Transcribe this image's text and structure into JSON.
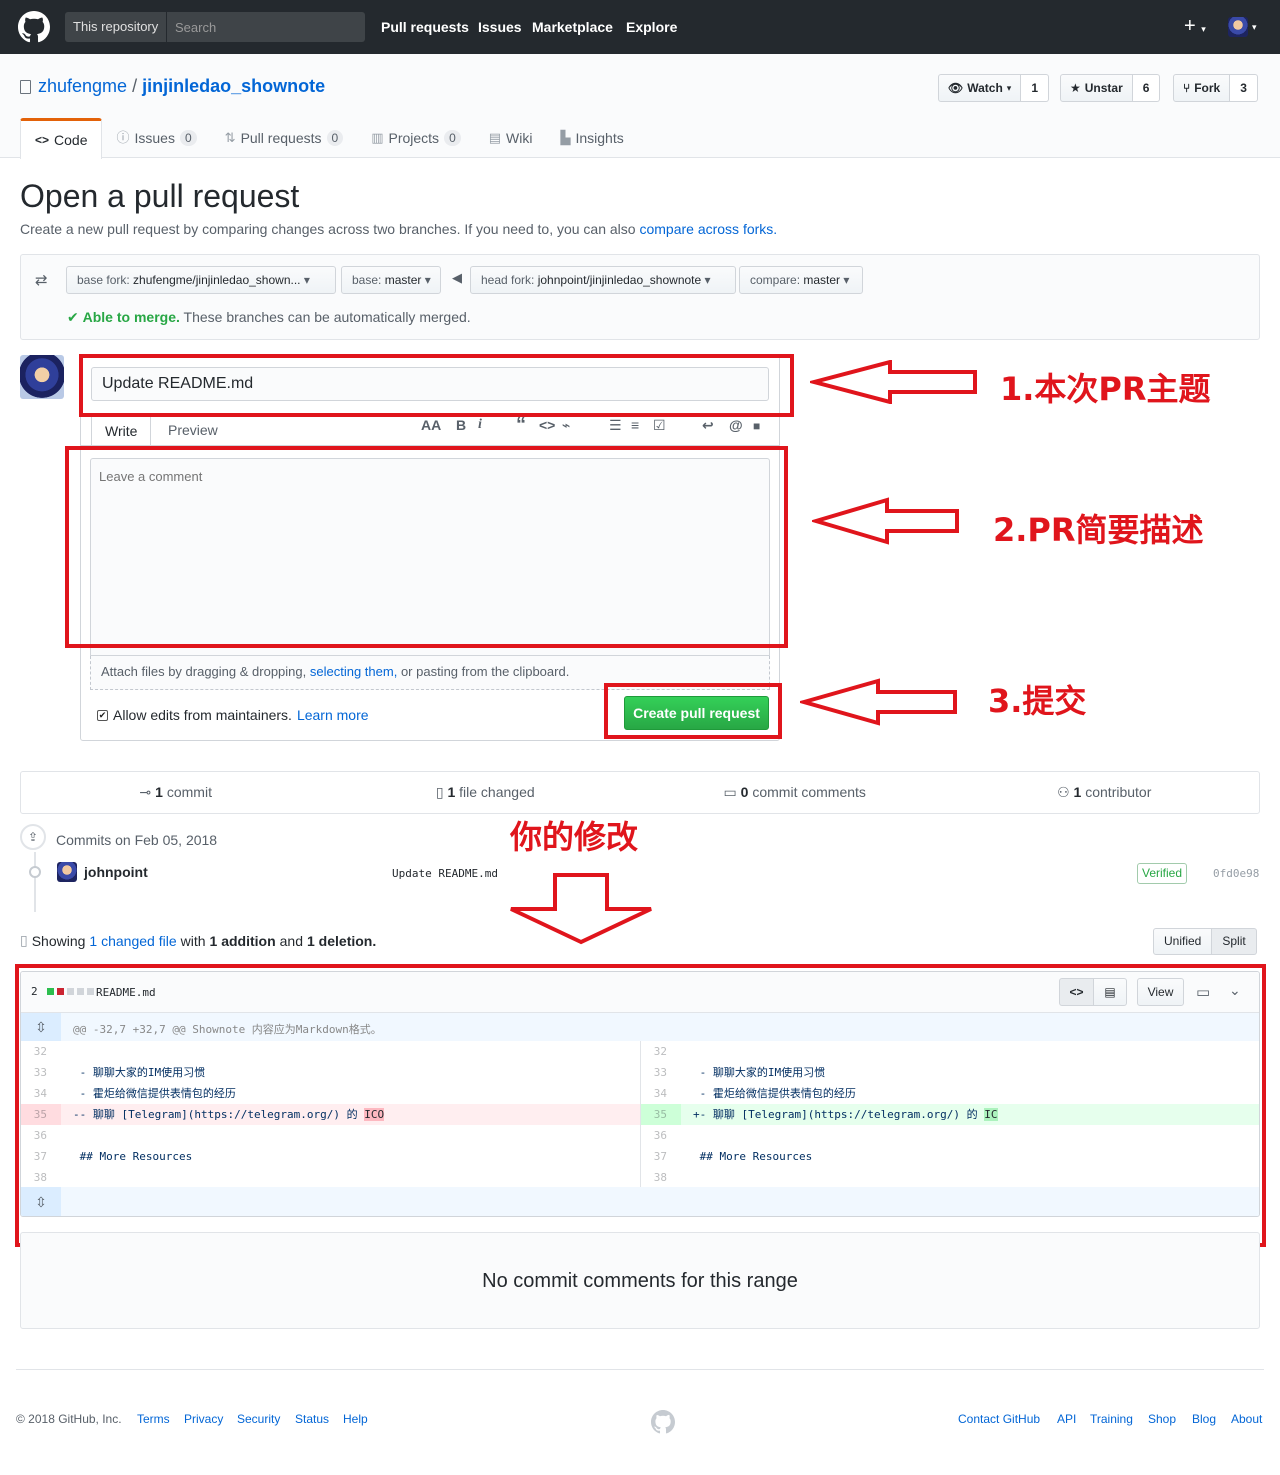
{
  "header": {
    "search_scope": "This repository",
    "search_placeholder": "Search",
    "nav": [
      "Pull requests",
      "Issues",
      "Marketplace",
      "Explore"
    ],
    "plus": "+"
  },
  "repo": {
    "owner": "zhufengme",
    "separator": "/",
    "name": "jinjinledao_shownote",
    "watch_label": "Watch",
    "watch_count": "1",
    "star_label": "Unstar",
    "star_count": "6",
    "fork_label": "Fork",
    "fork_count": "3",
    "tabs": [
      {
        "label": "Code",
        "icon": "<>"
      },
      {
        "label": "Issues",
        "count": "0"
      },
      {
        "label": "Pull requests",
        "count": "0"
      },
      {
        "label": "Projects",
        "count": "0"
      },
      {
        "label": "Wiki"
      },
      {
        "label": "Insights"
      }
    ]
  },
  "compare": {
    "title": "Open a pull request",
    "subtitle": "Create a new pull request by comparing changes across two branches. If you need to, you can also",
    "subtitle_link": "compare across forks.",
    "base_fork_label": "base fork:",
    "base_fork_value": "zhufengme/jinjinledao_shown...",
    "base_label": "base:",
    "base_value": "master",
    "head_fork_label": "head fork:",
    "head_fork_value": "johnpoint/jinjinledao_shownote",
    "compare_label": "compare:",
    "compare_value": "master",
    "merge_status": "Able to merge.",
    "merge_text": "These branches can be automatically merged."
  },
  "form": {
    "title_value": "Update README.md",
    "write_tab": "Write",
    "preview_tab": "Preview",
    "toolbar": [
      "AA",
      "B",
      "i",
      "“",
      "<>",
      "⌁",
      "☰",
      "≡",
      "☑",
      "↩",
      "@",
      "■"
    ],
    "comment_placeholder": "Leave a comment",
    "attach_prefix": "Attach files by dragging & dropping,",
    "attach_link": "selecting them,",
    "attach_suffix": "or pasting from the clipboard.",
    "allow_edits": "Allow edits from maintainers.",
    "learn_more": "Learn more",
    "submit": "Create pull request"
  },
  "annotations": {
    "a1": "1.本次PR主题",
    "a2": "2.PR简要描述",
    "a3": "3.提交",
    "a4": "你的修改"
  },
  "stats": {
    "commits": "1",
    "commits_label": "commit",
    "files": "1",
    "files_label": "file changed",
    "comments": "0",
    "comments_label": "commit comments",
    "contributors": "1",
    "contributors_label": "contributor"
  },
  "commits": {
    "date": "Commits on Feb 05, 2018",
    "author": "johnpoint",
    "message": "Update README.md",
    "verified": "Verified",
    "sha": "0fd0e98"
  },
  "showing": {
    "prefix": "Showing",
    "link": "1 changed file",
    "with": "with",
    "additions": "1 addition",
    "and": "and",
    "deletions": "1 deletion.",
    "unified": "Unified",
    "split": "Split"
  },
  "diff": {
    "stat_count": "2",
    "filename": "README.md",
    "view_label": "View",
    "hunk_header": "@@ -32,7 +32,7 @@ Shownote 内容应为Markdown格式。",
    "left": [
      {
        "num": "32",
        "text": "",
        "type": "ctx"
      },
      {
        "num": "33",
        "text": " - 聊聊大家的IM使用习惯",
        "type": "ctx"
      },
      {
        "num": "34",
        "text": " - 霍炬给微信提供表情包的经历",
        "type": "ctx"
      },
      {
        "num": "35",
        "text": "-- 聊聊 [Telegram](https://telegram.org/) 的 ",
        "hl": "ICO",
        "type": "del"
      },
      {
        "num": "36",
        "text": "",
        "type": "ctx"
      },
      {
        "num": "37",
        "text": " ## More Resources",
        "type": "ctx"
      },
      {
        "num": "38",
        "text": "",
        "type": "ctx"
      }
    ],
    "right": [
      {
        "num": "32",
        "text": "",
        "type": "ctx"
      },
      {
        "num": "33",
        "text": " - 聊聊大家的IM使用习惯",
        "type": "ctx"
      },
      {
        "num": "34",
        "text": " - 霍炬给微信提供表情包的经历",
        "type": "ctx"
      },
      {
        "num": "35",
        "text": "+- 聊聊 [Telegram](https://telegram.org/) 的 ",
        "hl": "IC",
        "type": "add"
      },
      {
        "num": "36",
        "text": "",
        "type": "ctx"
      },
      {
        "num": "37",
        "text": " ## More Resources",
        "type": "ctx"
      },
      {
        "num": "38",
        "text": "",
        "type": "ctx"
      }
    ]
  },
  "no_comments": "No commit comments for this range",
  "footer": {
    "copyright": "© 2018 GitHub, Inc.",
    "left_links": [
      "Terms",
      "Privacy",
      "Security",
      "Status",
      "Help"
    ],
    "right_links": [
      "Contact GitHub",
      "API",
      "Training",
      "Shop",
      "Blog",
      "About"
    ]
  },
  "colors": {
    "header_bg": "#24292e",
    "link": "#0366d6",
    "green": "#28a745",
    "annotation_red": "#e0151c"
  }
}
